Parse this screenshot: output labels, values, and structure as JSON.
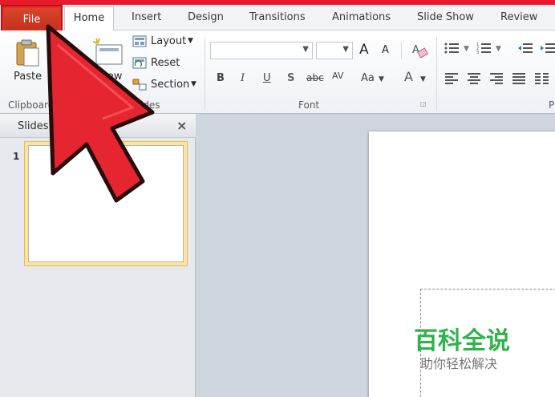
{
  "tabs": {
    "file": "File",
    "home": "Home",
    "items": [
      "Insert",
      "Design",
      "Transitions",
      "Animations",
      "Slide Show",
      "Review"
    ]
  },
  "ribbon": {
    "clipboard": {
      "paste": "Paste",
      "label": "Clipboard"
    },
    "slides": {
      "new_slide": "New",
      "layout": "Layout",
      "reset": "Reset",
      "section": "Section",
      "label": "Slides"
    },
    "font": {
      "label": "Font",
      "bold": "B",
      "italic": "I",
      "underline": "U",
      "shadow": "S",
      "strike": "abc",
      "spacing": "AV",
      "case": "Aa",
      "color": "A",
      "grow": "A",
      "shrink": "A"
    },
    "paragraph": {
      "label": "P"
    }
  },
  "slides_pane": {
    "title": "Slides",
    "close": "×",
    "thumb_number": "1"
  },
  "watermark": {
    "title": "百科全说",
    "subtitle": "助你轻松解决"
  },
  "colors": {
    "accent_red": "#e8192a",
    "file_tab": "#c4301c",
    "highlight": "#fbe3a3",
    "watermark_green": "#2fb34a"
  }
}
